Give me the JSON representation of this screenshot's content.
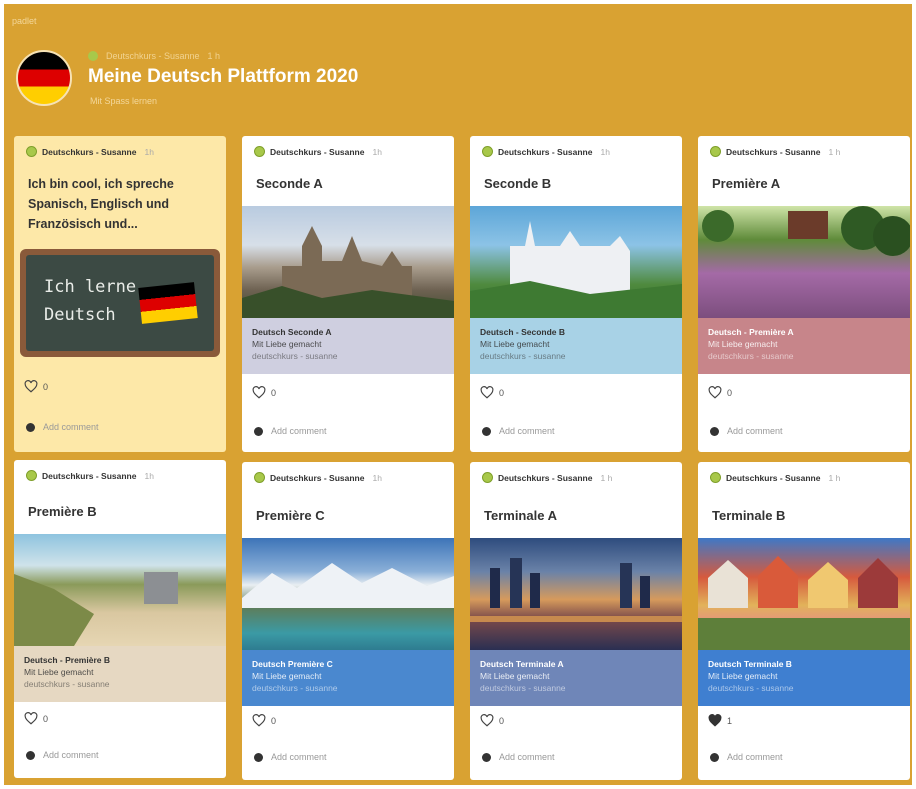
{
  "board": {
    "top_label": "padlet",
    "meta": [
      "Deutschkurs - Susanne",
      "1 h"
    ],
    "title": "Meine Deutsch Plattform 2020",
    "subtitle": "Mit Spass lernen"
  },
  "colors": {
    "background": "#d9a232",
    "note_yellow": "#fde8a8",
    "flag": [
      "#000000",
      "#dd0000",
      "#ffce00"
    ]
  },
  "cards": [
    {
      "author": "Deutschkurs - Susanne",
      "time": "1h",
      "text": "Ich bin cool,  ich spreche Spanisch, Englisch und Französisch und...",
      "image": "chalkboard",
      "chalk_lines": [
        "Ich lerne",
        "Deutsch"
      ],
      "likes": "0",
      "liked": false,
      "comment_placeholder": "Add comment"
    },
    {
      "author": "Deutschkurs - Susanne",
      "time": "1h",
      "title": "Seconde A",
      "image": "castle-hohenzollern",
      "link": {
        "title": "Deutsch Seconde A",
        "subtitle": "Mit Liebe gemacht",
        "source": "deutschkurs - susanne",
        "bg": "#cfcfe0",
        "fg": "#333333"
      },
      "likes": "0",
      "liked": false,
      "comment_placeholder": "Add comment"
    },
    {
      "author": "Deutschkurs - Susanne",
      "time": "1h",
      "title": "Seconde B",
      "image": "castle-neuschwanstein",
      "link": {
        "title": "Deutsch - Seconde B",
        "subtitle": "Mit Liebe gemacht",
        "source": "deutschkurs - susanne",
        "bg": "#a8d2e6",
        "fg": "#333333"
      },
      "likes": "0",
      "liked": false,
      "comment_placeholder": "Add comment"
    },
    {
      "author": "Deutschkurs - Susanne",
      "time": "1 h",
      "title": "Première A",
      "image": "heathland",
      "link": {
        "title": "Deutsch - Première A",
        "subtitle": "Mit Liebe gemacht",
        "source": "deutschkurs - susanne",
        "bg": "#c7858a",
        "fg": "#ffffff"
      },
      "likes": "0",
      "liked": false,
      "comment_placeholder": "Add comment"
    },
    {
      "author": "Deutschkurs - Susanne",
      "time": "1h",
      "title": "Première B",
      "image": "beach",
      "link": {
        "title": "Deutsch - Première B",
        "subtitle": "Mit Liebe gemacht",
        "source": "deutschkurs - susanne",
        "bg": "#e6d8c2",
        "fg": "#333333"
      },
      "likes": "0",
      "liked": false,
      "comment_placeholder": "Add comment"
    },
    {
      "author": "Deutschkurs - Susanne",
      "time": "1h",
      "title": "Première C",
      "image": "mountains",
      "link": {
        "title": "Deutsch Première C",
        "subtitle": "Mit Liebe gemacht",
        "source": "deutschkurs - susanne",
        "bg": "#4a88cf",
        "fg": "#ffffff"
      },
      "likes": "0",
      "liked": false,
      "comment_placeholder": "Add comment"
    },
    {
      "author": "Deutschkurs - Susanne",
      "time": "1 h",
      "title": "Terminale A",
      "image": "frankfurt",
      "link": {
        "title": "Deutsch Terminale A",
        "subtitle": "Mit Liebe gemacht",
        "source": "deutschkurs - susanne",
        "bg": "#6f86b8",
        "fg": "#ffffff"
      },
      "likes": "0",
      "liked": false,
      "comment_placeholder": "Add comment"
    },
    {
      "author": "Deutschkurs - Susanne",
      "time": "1 h",
      "title": "Terminale B",
      "image": "tuebingen",
      "link": {
        "title": "Deutsch Terminale B",
        "subtitle": "Mit Liebe gemacht",
        "source": "deutschkurs - susanne",
        "bg": "#3f7fd0",
        "fg": "#ffffff"
      },
      "likes": "1",
      "liked": true,
      "comment_placeholder": "Add comment"
    }
  ]
}
